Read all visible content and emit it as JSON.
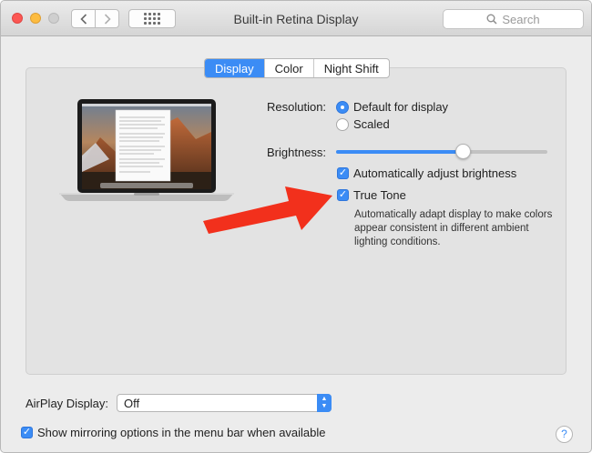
{
  "window": {
    "title": "Built-in Retina Display"
  },
  "search": {
    "placeholder": "Search"
  },
  "tabs": [
    {
      "label": "Display",
      "active": true
    },
    {
      "label": "Color",
      "active": false
    },
    {
      "label": "Night Shift",
      "active": false
    }
  ],
  "resolution": {
    "label": "Resolution:",
    "options": [
      {
        "label": "Default for display",
        "selected": true
      },
      {
        "label": "Scaled",
        "selected": false
      }
    ]
  },
  "brightness": {
    "label": "Brightness:",
    "level": 0.6,
    "auto_adjust": {
      "label": "Automatically adjust brightness",
      "checked": true
    }
  },
  "true_tone": {
    "label": "True Tone",
    "checked": true,
    "description": "Automatically adapt display to make colors appear consistent in different ambient lighting conditions."
  },
  "airplay": {
    "label": "AirPlay Display:",
    "value": "Off"
  },
  "mirroring": {
    "label": "Show mirroring options in the menu bar when available",
    "checked": true
  },
  "help": {
    "label": "?"
  },
  "colors": {
    "accent": "#3b8cf5",
    "arrow": "#f2301c"
  }
}
